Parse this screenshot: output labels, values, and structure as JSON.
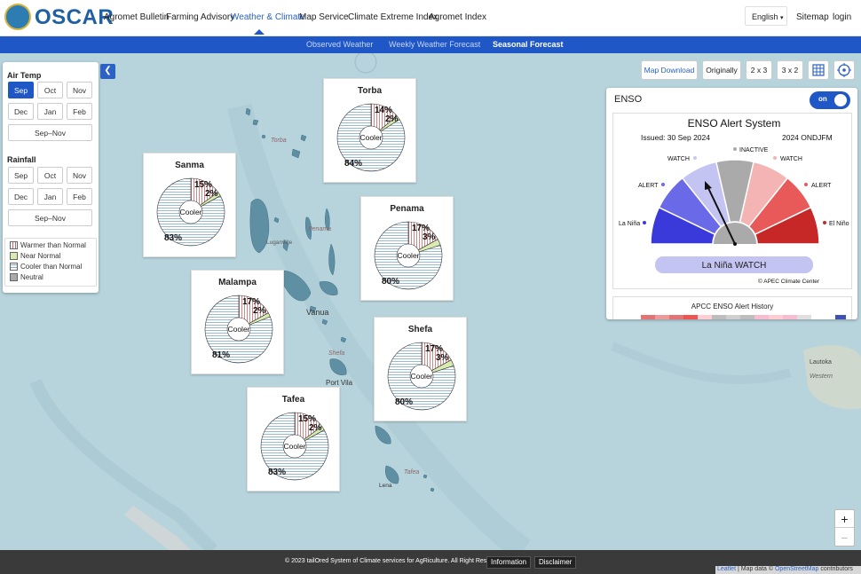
{
  "app": {
    "name": "OSCAR"
  },
  "nav": {
    "items": [
      "Agromet Bulletin",
      "Farming Advisory",
      "Weather & Climate",
      "Map Service",
      "Climate Extreme Index",
      "Agromet Index"
    ],
    "active": "Weather & Climate",
    "language": "English",
    "sitemap": "Sitemap",
    "login": "login"
  },
  "subnav": {
    "items": [
      "Observed Weather",
      "Weekly Weather Forecast",
      "Seasonal Forecast"
    ],
    "active": "Seasonal Forecast"
  },
  "left_panel": {
    "air_temp_title": "Air Temp",
    "air_temp_months": [
      "Sep",
      "Oct",
      "Nov",
      "Dec",
      "Jan",
      "Feb"
    ],
    "air_temp_selected": "Sep",
    "air_temp_season": "Sep–Nov",
    "rainfall_title": "Rainfall",
    "rainfall_months": [
      "Sep",
      "Oct",
      "Nov",
      "Dec",
      "Jan",
      "Feb"
    ],
    "rainfall_season": "Sep–Nov",
    "legend": [
      {
        "label": "Warmer than Normal",
        "color": "#e7a8a8"
      },
      {
        "label": "Near Normal",
        "color": "#b6d96f"
      },
      {
        "label": "Cooler than Normal",
        "color": "#b8d4e6"
      },
      {
        "label": "Neutral",
        "color": "#aaaaaa"
      }
    ]
  },
  "toolbar": {
    "map_download": "Map Download",
    "originally": "Originally",
    "grid_2x3": "2 x 3",
    "grid_3x2": "3 x 2"
  },
  "regions": [
    {
      "name": "Torba",
      "warm": 14,
      "near": 2,
      "cool": 84,
      "center": "Cooler"
    },
    {
      "name": "Sanma",
      "warm": 15,
      "near": 2,
      "cool": 83,
      "center": "Cooler"
    },
    {
      "name": "Penama",
      "warm": 17,
      "near": 3,
      "cool": 80,
      "center": "Cooler"
    },
    {
      "name": "Malampa",
      "warm": 17,
      "near": 2,
      "cool": 81,
      "center": "Cooler"
    },
    {
      "name": "Shefa",
      "warm": 17,
      "near": 3,
      "cool": 80,
      "center": "Cooler"
    },
    {
      "name": "Tafea",
      "warm": 15,
      "near": 2,
      "cool": 83,
      "center": "Cooler"
    }
  ],
  "map_labels": {
    "torba": "Torba",
    "luganville": "Luganville",
    "penama": "Penama",
    "vanua": "Vanua",
    "shefa": "Shefa",
    "port_vila": "Port Vila",
    "tafea": "Tafea",
    "lenakel": "Lena",
    "lautoka": "Lautoka",
    "western": "Western"
  },
  "enso": {
    "title": "ENSO",
    "toggle": "on",
    "chart_title": "ENSO Alert System",
    "issued": "Issued: 30 Sep 2024",
    "season": "2024 ONDJFM",
    "labels": [
      "La Niña",
      "ALERT",
      "WATCH",
      "INACTIVE",
      "WATCH",
      "ALERT",
      "El Niño"
    ],
    "current": "La Niña WATCH",
    "credit": "© APEC Climate Center",
    "history_title": "APCC ENSO Alert History"
  },
  "footer": {
    "copyright": "© 2023 tailOred System of Climate services for AgRiculture. All Right Reserved.",
    "information": "Information",
    "disclaimer": "Disclaimer",
    "attribution_leaflet": "Leaflet",
    "attribution_text": " | Map data © ",
    "attribution_osm": "OpenStreetMap",
    "attribution_end": " contributors"
  }
}
